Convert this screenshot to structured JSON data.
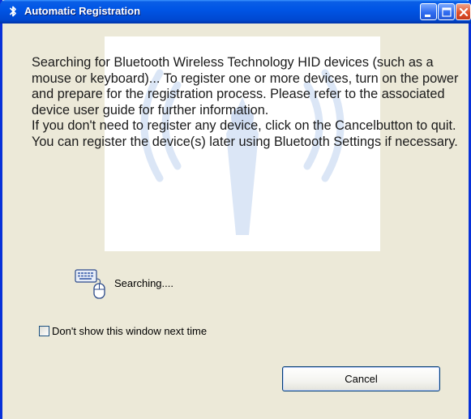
{
  "window": {
    "title": "Automatic Registration",
    "controls": {
      "minimize_icon": "minimize-icon",
      "maximize_icon": "maximize-icon",
      "close_icon": "close-icon"
    }
  },
  "message": {
    "paragraph1": "Searching for Bluetooth Wireless Technology HID devices (such as a mouse or keyboard)... To register one or more devices, turn on the power and prepare for the registration process. Please refer to the associated device user guide for further information.",
    "paragraph2": "If you don't need to register any device, click on the Cancelbutton to quit. You can register the device(s) later using Bluetooth Settings if necessary."
  },
  "status": {
    "icon": "keyboard-mouse-icon",
    "text": "Searching...."
  },
  "checkbox": {
    "label": "Don't show this window next time",
    "checked": false
  },
  "buttons": {
    "cancel_label": "Cancel"
  },
  "colors": {
    "titlebar": "#0055e5",
    "window_bg": "#ece9d8",
    "frame": "#0831d9",
    "close_button": "#e0512c"
  }
}
